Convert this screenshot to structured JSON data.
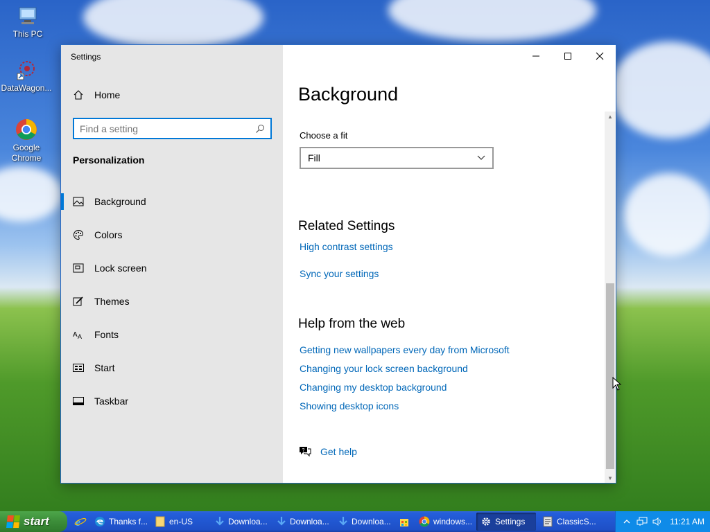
{
  "desktop": {
    "icons": [
      {
        "label": "This PC",
        "icon": "computer-icon"
      },
      {
        "label": "DataWagon...",
        "icon": "datawagon-shortcut-icon"
      },
      {
        "label": "Google Chrome",
        "icon": "chrome-icon"
      }
    ]
  },
  "window": {
    "title": "Settings",
    "controls": {
      "minimize": "–",
      "maximize": "☐",
      "close": "✕"
    },
    "sidebar": {
      "home_label": "Home",
      "search_placeholder": "Find a setting",
      "section_title": "Personalization",
      "items": [
        {
          "label": "Background",
          "icon": "image-icon",
          "active": true
        },
        {
          "label": "Colors",
          "icon": "palette-icon"
        },
        {
          "label": "Lock screen",
          "icon": "lock-screen-icon"
        },
        {
          "label": "Themes",
          "icon": "brush-icon"
        },
        {
          "label": "Fonts",
          "icon": "font-icon"
        },
        {
          "label": "Start",
          "icon": "start-icon"
        },
        {
          "label": "Taskbar",
          "icon": "taskbar-icon"
        }
      ]
    },
    "content": {
      "title": "Background",
      "fit_label": "Choose a fit",
      "fit_value": "Fill",
      "related_title": "Related Settings",
      "related_links": [
        "High contrast settings",
        "Sync your settings"
      ],
      "help_title": "Help from the web",
      "help_links": [
        "Getting new wallpapers every day from Microsoft",
        "Changing your lock screen background",
        "Changing my desktop background",
        "Showing desktop icons"
      ],
      "get_help": "Get help"
    }
  },
  "taskbar": {
    "start_label": "start",
    "buttons": [
      {
        "label": "Thanks f...",
        "icon": "edge-icon"
      },
      {
        "label": "en-US",
        "icon": "folder-icon"
      },
      {
        "label": "Downloa...",
        "icon": "download-icon"
      },
      {
        "label": "Downloa...",
        "icon": "download-icon"
      },
      {
        "label": "Downloa...",
        "icon": "download-icon"
      },
      {
        "label": "",
        "icon": "store-icon"
      },
      {
        "label": "windows...",
        "icon": "chrome-icon"
      },
      {
        "label": "Settings",
        "icon": "gear-icon",
        "active": true
      },
      {
        "label": "ClassicS...",
        "icon": "classicshell-icon"
      }
    ],
    "clock": "11:21 AM"
  }
}
